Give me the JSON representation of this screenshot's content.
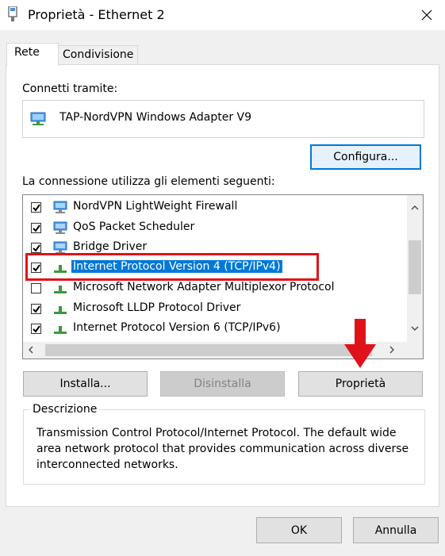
{
  "window": {
    "title": "Proprietà - Ethernet 2"
  },
  "tabs": [
    {
      "label": "Rete"
    },
    {
      "label": "Condivisione"
    }
  ],
  "connect_via": {
    "label": "Connetti tramite:",
    "adapter": "TAP-NordVPN Windows Adapter V9",
    "configure_button": "Configura..."
  },
  "items_section": {
    "label": "La connessione utilizza gli elementi seguenti:",
    "items": [
      {
        "label": "NordVPN LightWeight Firewall",
        "checked": true,
        "icon": "network-client-icon"
      },
      {
        "label": "QoS Packet Scheduler",
        "checked": true,
        "icon": "network-client-icon"
      },
      {
        "label": "Bridge Driver",
        "checked": true,
        "icon": "network-client-icon"
      },
      {
        "label": "Internet Protocol Version 4 (TCP/IPv4)",
        "checked": true,
        "selected": true,
        "icon": "protocol-icon"
      },
      {
        "label": "Microsoft Network Adapter Multiplexor Protocol",
        "checked": false,
        "icon": "protocol-icon"
      },
      {
        "label": "Microsoft LLDP Protocol Driver",
        "checked": true,
        "icon": "protocol-icon"
      },
      {
        "label": "Internet Protocol Version 6 (TCP/IPv6)",
        "checked": true,
        "icon": "protocol-icon"
      }
    ]
  },
  "buttons": {
    "install": "Installa...",
    "uninstall": "Disinstalla",
    "properties": "Proprietà",
    "ok": "OK",
    "cancel": "Annulla"
  },
  "description": {
    "legend": "Descrizione",
    "text": "Transmission Control Protocol/Internet Protocol. The default wide area network protocol that provides communication across diverse interconnected networks."
  },
  "colors": {
    "selection": "#0078d7",
    "annotation": "#e1111a"
  }
}
